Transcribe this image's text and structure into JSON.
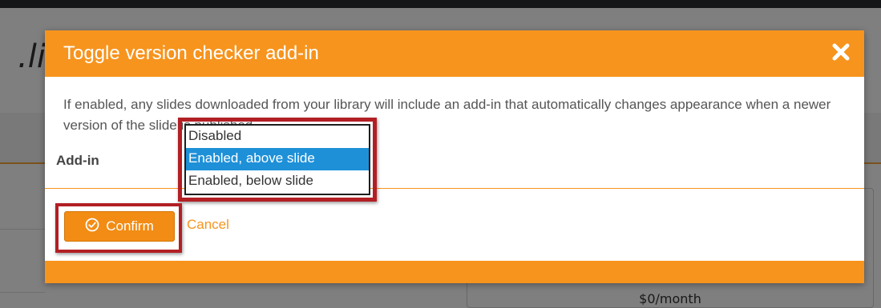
{
  "background": {
    "title_fragment": ".lib",
    "price": "$0/month"
  },
  "modal": {
    "title": "Toggle version checker add-in",
    "close_icon": "close-icon",
    "description": "If enabled, any slides downloaded from your library will include an add-in that automatically changes appearance when a newer version of the slide is published.",
    "addin_label": "Add-in",
    "select": {
      "options": [
        "Disabled",
        "Enabled, above slide",
        "Enabled, below slide"
      ],
      "selected_index": 1
    },
    "confirm_label": "Confirm",
    "confirm_icon": "check-circle-icon",
    "cancel_label": "Cancel"
  },
  "colors": {
    "accent": "#f7941d",
    "highlight": "#b21f24",
    "selection": "#1e90d8"
  }
}
